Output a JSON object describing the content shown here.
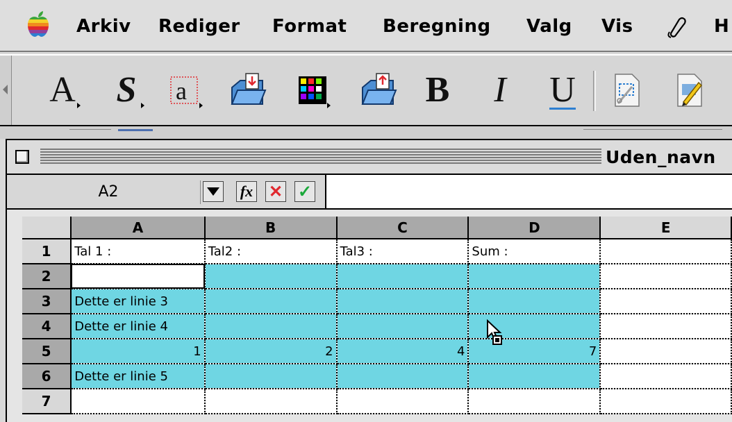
{
  "menubar": {
    "items": [
      "Arkiv",
      "Rediger",
      "Format",
      "Beregning",
      "Valg",
      "Vis",
      "H"
    ],
    "script_icon": "script-menu-icon",
    "apple_icon": "apple-logo-icon"
  },
  "toolbar": {
    "buttons": [
      {
        "name": "font-button",
        "glyph": "A",
        "has_menu": true
      },
      {
        "name": "size-button",
        "glyph": "S",
        "has_menu": true
      },
      {
        "name": "text-frame-button",
        "glyph": "a",
        "has_menu": true
      },
      {
        "name": "import-icon",
        "has_menu": false
      },
      {
        "name": "color-palette-icon",
        "has_menu": true
      },
      {
        "name": "export-icon",
        "has_menu": false
      },
      {
        "name": "bold-button",
        "glyph": "B",
        "has_menu": false
      },
      {
        "name": "italic-button",
        "glyph": "I",
        "has_menu": false
      },
      {
        "name": "underline-button",
        "glyph": "U",
        "has_menu": false
      },
      {
        "name": "draw-icon",
        "has_menu": false
      },
      {
        "name": "pencil-icon",
        "has_menu": false
      }
    ]
  },
  "window": {
    "title": "Uden_navn"
  },
  "formula_bar": {
    "cell_ref": "A2",
    "fx_label": "fx",
    "cancel_label": "✕",
    "confirm_label": "✓",
    "value": ""
  },
  "sheet": {
    "columns": [
      "A",
      "B",
      "C",
      "D",
      "E"
    ],
    "selected_columns": [
      "A",
      "B",
      "C",
      "D"
    ],
    "active_cell": "A2",
    "highlight_color": "#6fd6e3",
    "rows": [
      {
        "label": "1",
        "selected": false,
        "cells": [
          "Tal 1 :",
          "Tal2 :",
          "Tal3 :",
          "Sum :",
          ""
        ]
      },
      {
        "label": "2",
        "selected": true,
        "cells": [
          "",
          "",
          "",
          "",
          ""
        ]
      },
      {
        "label": "3",
        "selected": true,
        "cells": [
          "Dette er linie 3",
          "",
          "",
          "",
          ""
        ]
      },
      {
        "label": "4",
        "selected": true,
        "cells": [
          "Dette er linie 4",
          "",
          "",
          "",
          ""
        ]
      },
      {
        "label": "5",
        "selected": true,
        "cells": [
          "1",
          "2",
          "4",
          "7",
          ""
        ]
      },
      {
        "label": "6",
        "selected": true,
        "cells": [
          "Dette er linie 5",
          "",
          "",
          "",
          ""
        ]
      },
      {
        "label": "7",
        "selected": false,
        "cells": [
          "",
          "",
          "",
          "",
          ""
        ]
      }
    ]
  }
}
